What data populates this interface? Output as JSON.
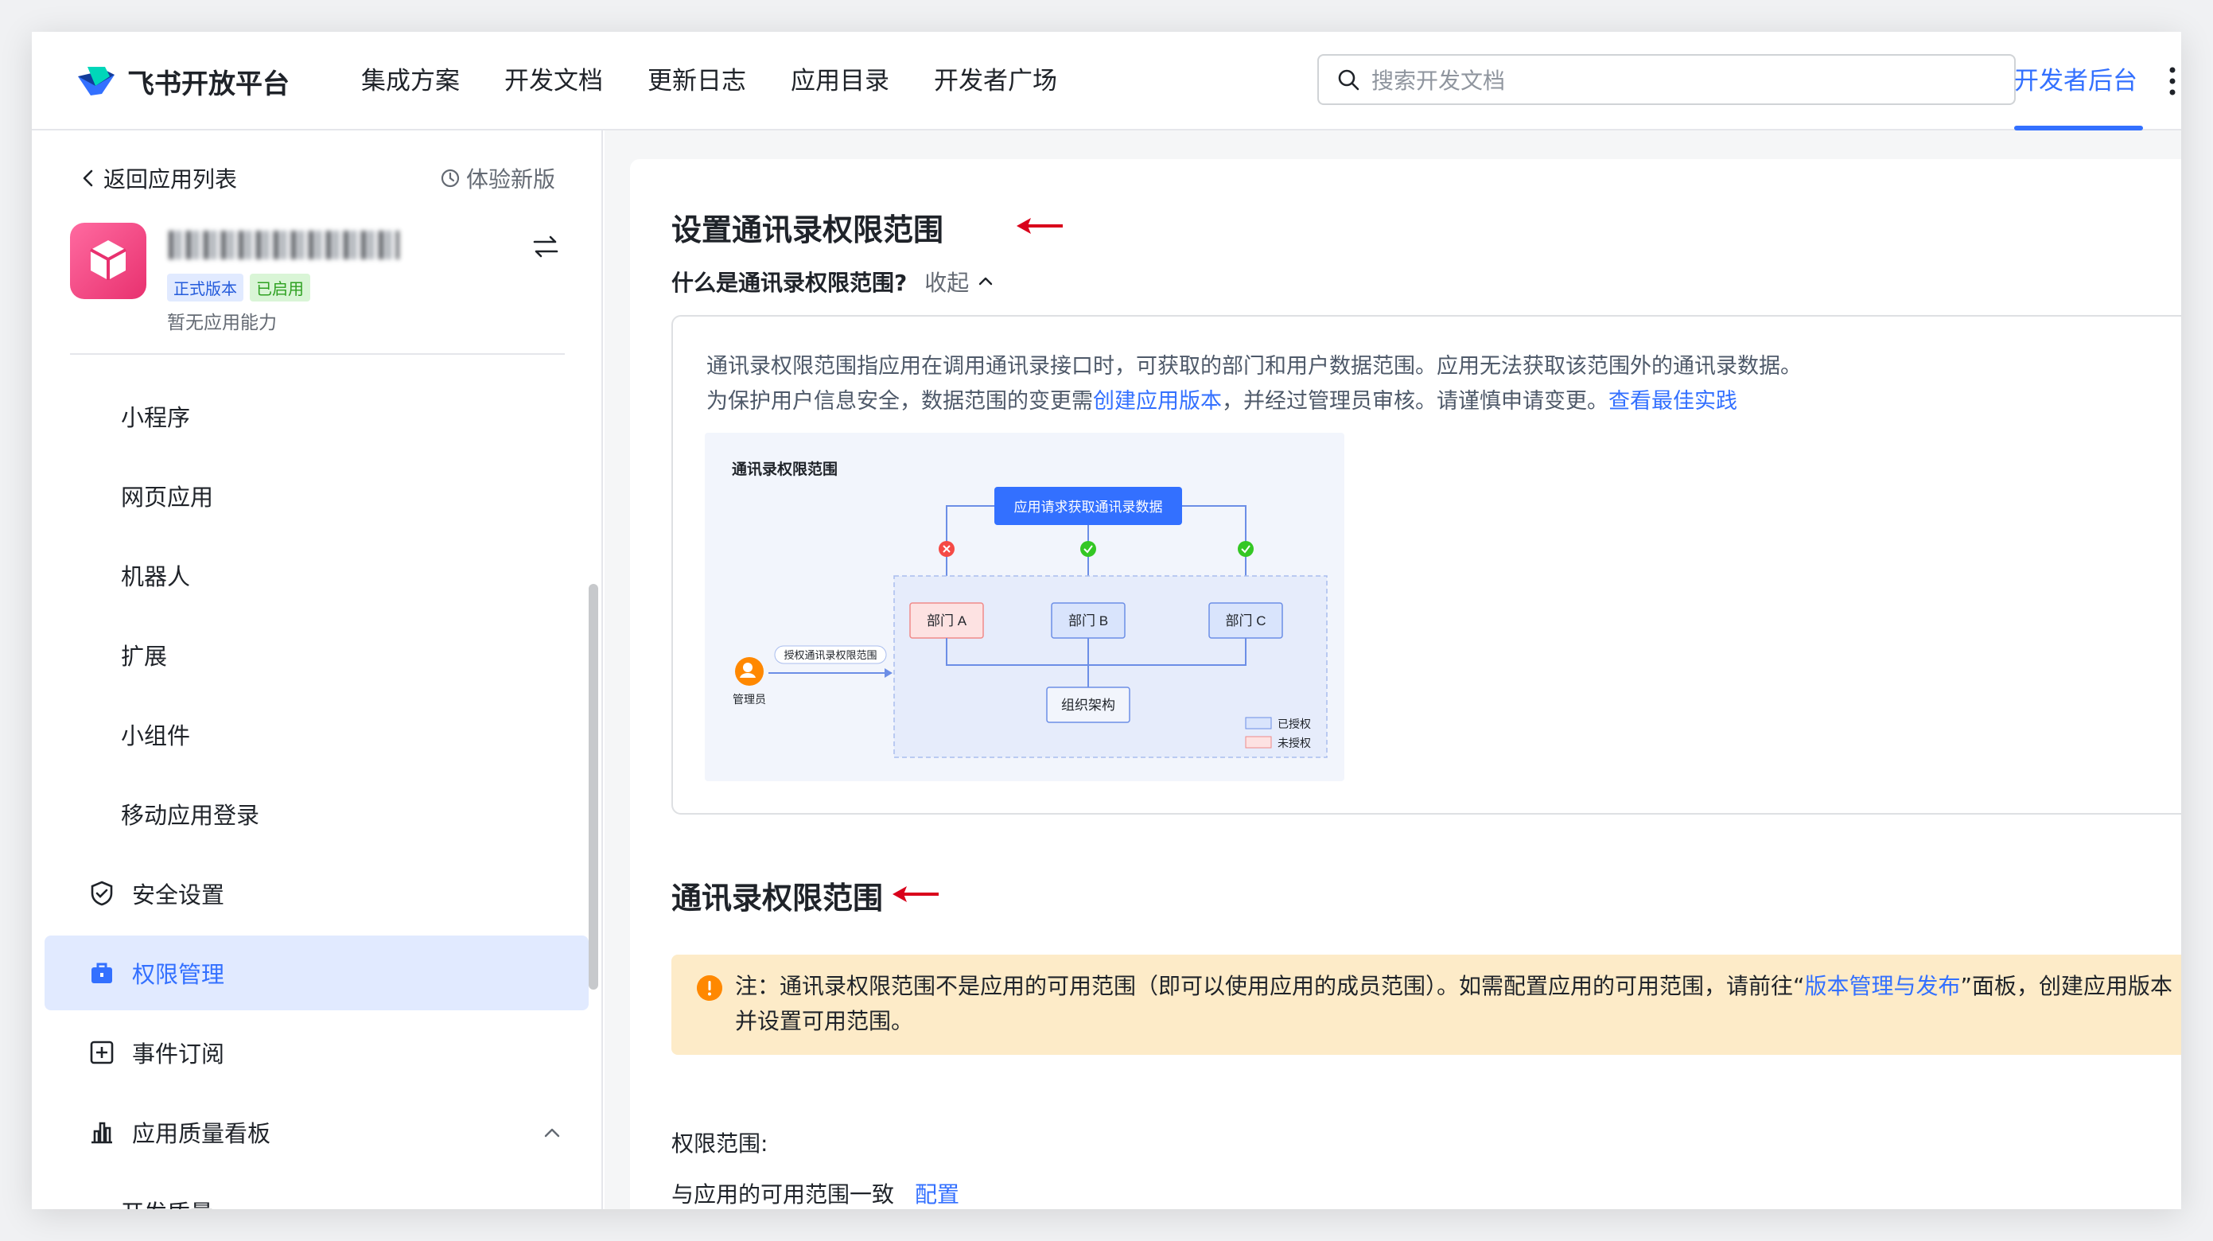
{
  "header": {
    "brand": "飞书开放平台",
    "nav": [
      "集成方案",
      "开发文档",
      "更新日志",
      "应用目录",
      "开发者广场"
    ],
    "search_placeholder": "搜索开发文档",
    "dev_console": "开发者后台"
  },
  "sidebar": {
    "back_label": "返回应用列表",
    "try_new_label": "体验新版",
    "app": {
      "badge_release": "正式版本",
      "badge_enabled": "已启用",
      "capability_text": "暂无应用能力"
    },
    "sub_items": [
      "小程序",
      "网页应用",
      "机器人",
      "扩展",
      "小组件",
      "移动应用登录"
    ],
    "menu": {
      "security": "安全设置",
      "permissions": "权限管理",
      "events": "事件订阅",
      "quality_board": "应用质量看板",
      "dev_quality": "开发质量"
    }
  },
  "main": {
    "section1_title": "设置通讯录权限范围",
    "what_is_label": "什么是通讯录权限范围?",
    "collapse_label": "收起",
    "desc_line1": "通讯录权限范围指应用在调用通讯录接口时，可获取的部门和用户数据范围。应用无法获取该范围外的通讯录数据。",
    "desc_line2_a": "为保护用户信息安全，数据范围的变更需",
    "desc_line2_link1": "创建应用版本",
    "desc_line2_b": "，并经过管理员审核。请谨慎申请变更。",
    "desc_line2_link2": "查看最佳实践",
    "diagram": {
      "title": "通讯录权限范围",
      "request": "应用请求获取通讯录数据",
      "dept_a": "部门 A",
      "dept_b": "部门 B",
      "dept_c": "部门 C",
      "org": "组织架构",
      "grant": "授权通讯录权限范围",
      "admin": "管理员",
      "legend_granted": "已授权",
      "legend_not_granted": "未授权"
    },
    "section2_title": "通讯录权限范围",
    "notice_a": "注：通讯录权限范围不是应用的可用范围（即可以使用应用的成员范围）。如需配置应用的可用范围，请前往“",
    "notice_link": "版本管理与发布",
    "notice_b": "”面板，创建应用版本并设置可用范围。",
    "scope_label": "权限范围:",
    "scope_value": "与应用的可用范围一致",
    "scope_config": "配置"
  },
  "colors": {
    "accent": "#3370ff",
    "active_bg": "#e1eaff",
    "notice_bg": "#fdebc8",
    "annotation_arrow": "#d9001b"
  }
}
